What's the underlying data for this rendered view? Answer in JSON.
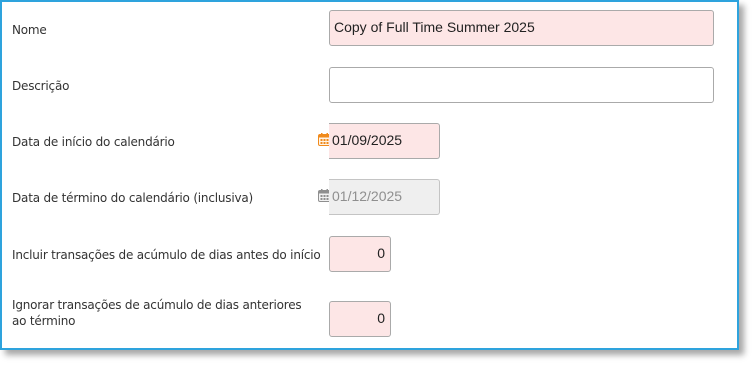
{
  "form": {
    "name": {
      "label": "Nome",
      "value": "Copy of Full Time Summer 2025"
    },
    "description": {
      "label": "Descrição",
      "value": ""
    },
    "start_date": {
      "label": "Data de início do calendário",
      "value": "01/09/2025",
      "icon": "calendar-icon",
      "icon_color": "#f08a1c"
    },
    "end_date": {
      "label": "Data de término do calendário (inclusiva)",
      "value": "01/12/2025",
      "icon": "calendar-icon",
      "icon_color": "#8f8f8f"
    },
    "include_accrual": {
      "label": "Incluir transações de acúmulo de dias antes do início",
      "value": "0"
    },
    "ignore_accrual": {
      "label": "Ignorar transações de acúmulo de dias anteriores ao término",
      "value": "0"
    }
  },
  "colors": {
    "frame_border": "#2ea3dd",
    "required_field_bg": "#fde6e6",
    "disabled_field_bg": "#efefef"
  }
}
